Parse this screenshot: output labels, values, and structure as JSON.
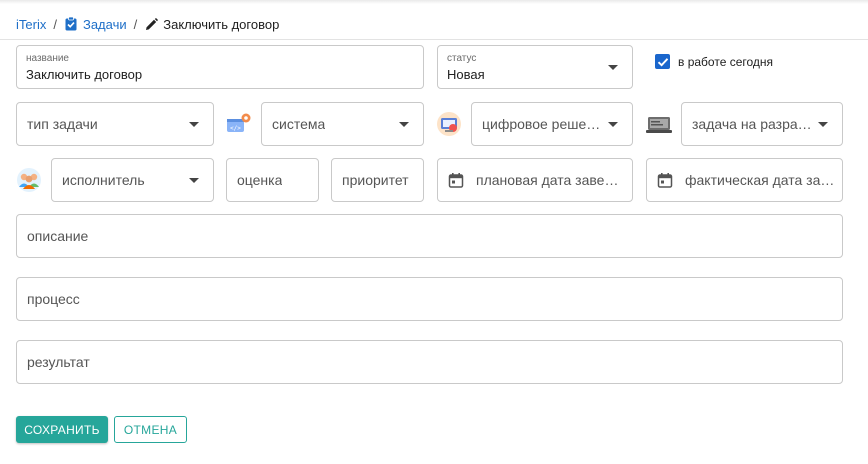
{
  "breadcrumb": {
    "root": "iTerix",
    "separator": "/",
    "section": "Задачи",
    "current": "Заключить договор"
  },
  "form": {
    "name": {
      "label": "название",
      "value": "Заключить договор"
    },
    "status": {
      "label": "статус",
      "value": "Новая"
    },
    "today": {
      "label": "в работе сегодня",
      "checked": true
    },
    "task_type": {
      "placeholder": "тип задачи"
    },
    "system": {
      "placeholder": "система"
    },
    "digital_solution": {
      "placeholder": "цифровое решение"
    },
    "dev_task": {
      "placeholder": "задача на разрабо..."
    },
    "assignee": {
      "placeholder": "исполнитель"
    },
    "estimate": {
      "placeholder": "оценка"
    },
    "priority": {
      "placeholder": "приоритет"
    },
    "planned_date": {
      "placeholder": "плановая дата заверше..."
    },
    "actual_date": {
      "placeholder": "фактическая дата заве..."
    },
    "description": {
      "placeholder": "описание"
    },
    "process": {
      "placeholder": "процесс"
    },
    "result": {
      "placeholder": "результат"
    }
  },
  "actions": {
    "save_label": "СОХРАНИТЬ",
    "cancel_label": "ОТМЕНА"
  },
  "icons": {
    "tasks": "clipboard-check-icon",
    "edit": "pencil-icon",
    "system": "system-icon",
    "digital": "digital-solution-icon",
    "devtask": "laptop-icon",
    "assignee": "people-icon",
    "calendar": "calendar-icon"
  },
  "colors": {
    "accent": "#26a69a",
    "link": "#1e6fc8",
    "checkbox": "#1a66cc"
  }
}
